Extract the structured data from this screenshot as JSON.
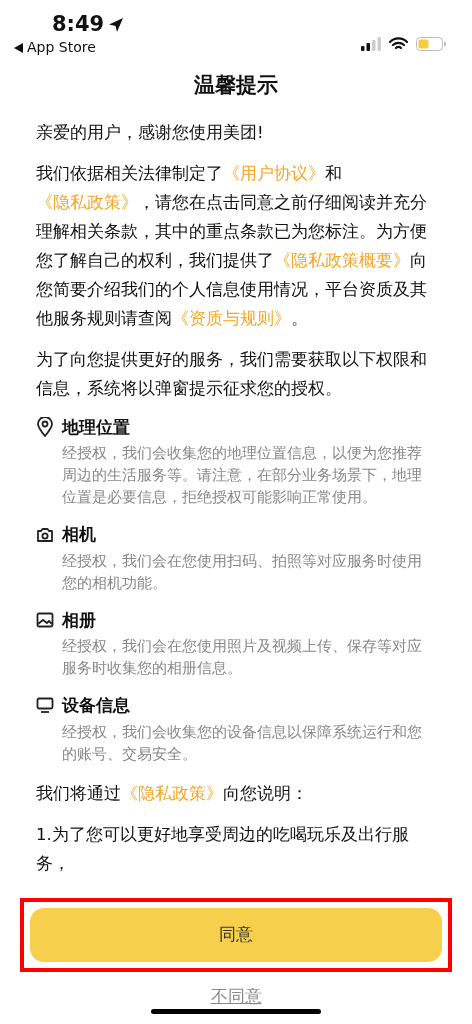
{
  "status_bar": {
    "time": "8:49",
    "back_label": "App Store"
  },
  "title": "温馨提示",
  "intro": [
    [
      {
        "text": "亲爱的用户，感谢您使用美团!",
        "kind": "text"
      }
    ],
    [
      {
        "text": "我们依据相关法律制定了",
        "kind": "text"
      },
      {
        "text": "《用户协议》",
        "kind": "link"
      },
      {
        "text": "和",
        "kind": "text"
      },
      {
        "text": "《隐私政策》",
        "kind": "link"
      },
      {
        "text": "，请您在点击同意之前仔细阅读并充分理解相关条款，其中的重点条款已为您标注。为方便您了解自己的权利，我们提供了",
        "kind": "text"
      },
      {
        "text": "《隐私政策概要》",
        "kind": "link"
      },
      {
        "text": "向您简要介绍我们的个人信息使用情况，平台资质及其他服务规则请查阅",
        "kind": "text"
      },
      {
        "text": "《资质与规则》",
        "kind": "link"
      },
      {
        "text": "。",
        "kind": "text"
      }
    ],
    [
      {
        "text": "为了向您提供更好的服务，我们需要获取以下权限和信息，系统将以弹窗提示征求您的授权。",
        "kind": "text"
      }
    ]
  ],
  "permissions": [
    {
      "kind": "location",
      "title": "地理位置",
      "description": "经授权，我们会收集您的地理位置信息，以便为您推荐周边的生活服务等。请注意，在部分业务场景下，地理位置是必要信息，拒绝授权可能影响正常使用。"
    },
    {
      "kind": "camera",
      "title": "相机",
      "description": "经授权，我们会在您使用扫码、拍照等对应服务时使用您的相机功能。"
    },
    {
      "kind": "album",
      "title": "相册",
      "description": "经授权，我们会在您使用照片及视频上传、保存等对应服务时收集您的相册信息。"
    },
    {
      "kind": "device",
      "title": "设备信息",
      "description": "经授权，我们会收集您的设备信息以保障系统运行和您的账号、交易安全。"
    }
  ],
  "closing": [
    [
      {
        "text": "我们将通过",
        "kind": "text"
      },
      {
        "text": "《隐私政策》",
        "kind": "link"
      },
      {
        "text": "向您说明：",
        "kind": "text"
      }
    ],
    [
      {
        "text": "1.为了您可以更好地享受周边的吃喝玩乐及出行服务，",
        "kind": "text"
      }
    ]
  ],
  "agree_button": {
    "label": "同意",
    "highlighted": true
  },
  "disagree_link": "不同意"
}
